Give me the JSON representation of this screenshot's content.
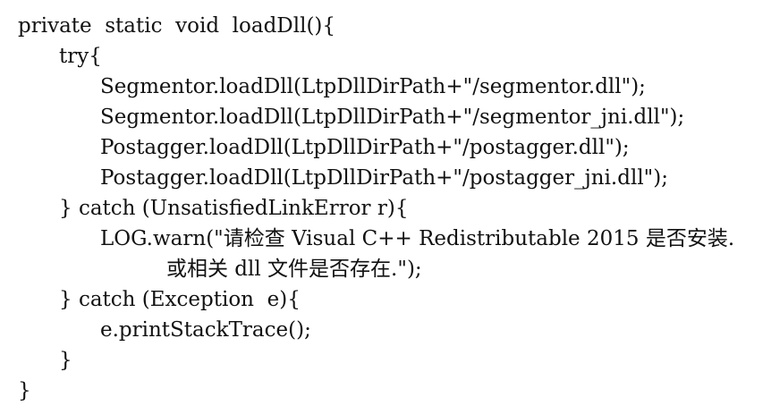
{
  "code": {
    "lines": [
      "private  static  void  loadDll(){",
      "try{",
      "Segmentor.loadDll(LtpDllDirPath+\"/segmentor.dll\");",
      "Segmentor.loadDll(LtpDllDirPath+\"/segmentor_jni.dll\");",
      "Postagger.loadDll(LtpDllDirPath+\"/postagger.dll\");",
      "Postagger.loadDll(LtpDllDirPath+\"/postagger_jni.dll\");",
      "} catch (UnsatisfiedLinkError r){",
      "LOG.warn(\"请检查 Visual C++ Redistributable 2015 是否安装.",
      "或相关 dll 文件是否存在.\");",
      "} catch (Exception  e){",
      "e.printStackTrace();",
      "}",
      "}"
    ]
  }
}
